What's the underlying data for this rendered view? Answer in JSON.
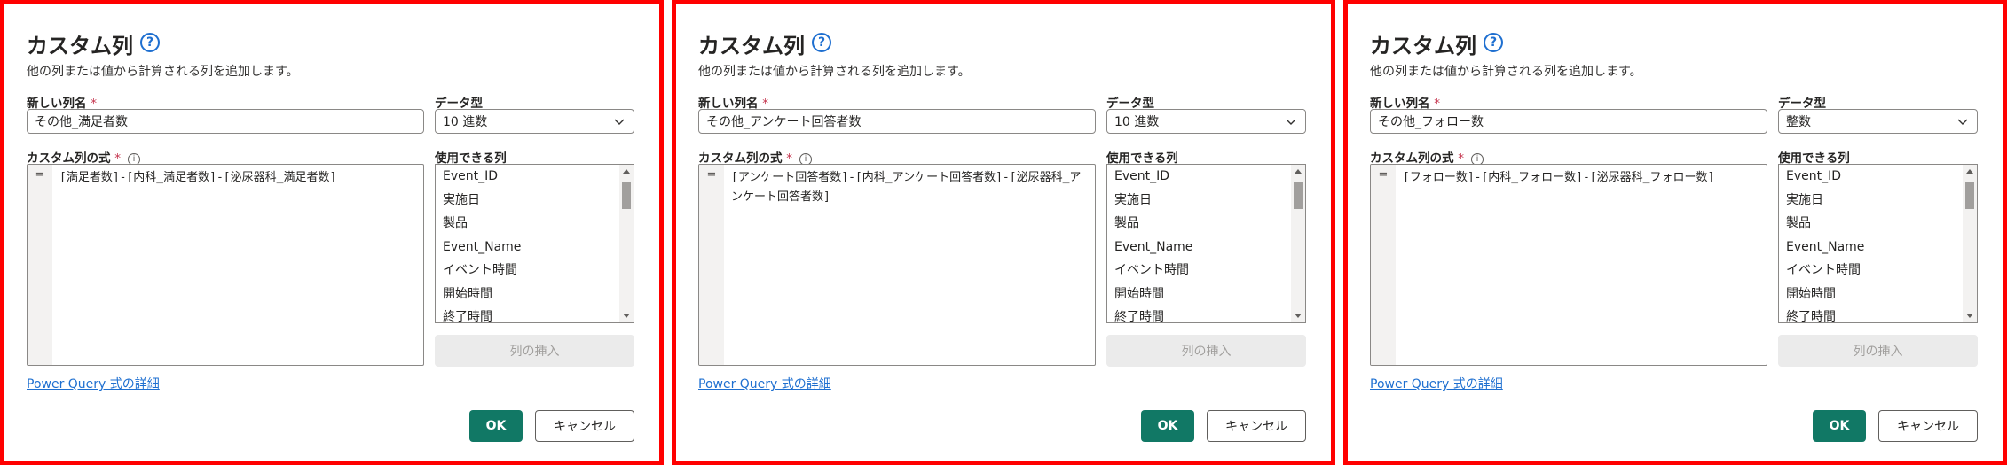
{
  "dialogs": [
    {
      "title": "カスタム列",
      "description": "他の列または値から計算される列を追加します。",
      "new_column_label": "新しい列名",
      "required_mark": "*",
      "column_name": "その他_満足者数",
      "data_type_label": "データ型",
      "data_type": "10 進数",
      "formula_label": "カスタム列の式",
      "equals_sign": "=",
      "formula": "[満足者数]-[内科_満足者数]-[泌尿器科_満足者数]",
      "available_columns_label": "使用できる列",
      "available_columns": [
        "Event_ID",
        "実施日",
        "製品",
        "Event_Name",
        "イベント時間",
        "開始時間",
        "終了時間"
      ],
      "insert_button": "列の挿入",
      "link": "Power Query 式の詳細",
      "ok_button": "OK",
      "cancel_button": "キャンセル"
    },
    {
      "title": "カスタム列",
      "description": "他の列または値から計算される列を追加します。",
      "new_column_label": "新しい列名",
      "required_mark": "*",
      "column_name": "その他_アンケート回答者数",
      "data_type_label": "データ型",
      "data_type": "10 進数",
      "formula_label": "カスタム列の式",
      "equals_sign": "=",
      "formula": "[アンケート回答者数]-[内科_アンケート回答者数]-[泌尿器科_アンケート回答者数]",
      "available_columns_label": "使用できる列",
      "available_columns": [
        "Event_ID",
        "実施日",
        "製品",
        "Event_Name",
        "イベント時間",
        "開始時間",
        "終了時間"
      ],
      "insert_button": "列の挿入",
      "link": "Power Query 式の詳細",
      "ok_button": "OK",
      "cancel_button": "キャンセル"
    },
    {
      "title": "カスタム列",
      "description": "他の列または値から計算される列を追加します。",
      "new_column_label": "新しい列名",
      "required_mark": "*",
      "column_name": "その他_フォロー数",
      "data_type_label": "データ型",
      "data_type": "整数",
      "formula_label": "カスタム列の式",
      "equals_sign": "=",
      "formula": "[フォロー数]-[内科_フォロー数]-[泌尿器科_フォロー数]",
      "available_columns_label": "使用できる列",
      "available_columns": [
        "Event_ID",
        "実施日",
        "製品",
        "Event_Name",
        "イベント時間",
        "開始時間",
        "終了時間"
      ],
      "insert_button": "列の挿入",
      "link": "Power Query 式の詳細",
      "ok_button": "OK",
      "cancel_button": "キャンセル"
    }
  ]
}
